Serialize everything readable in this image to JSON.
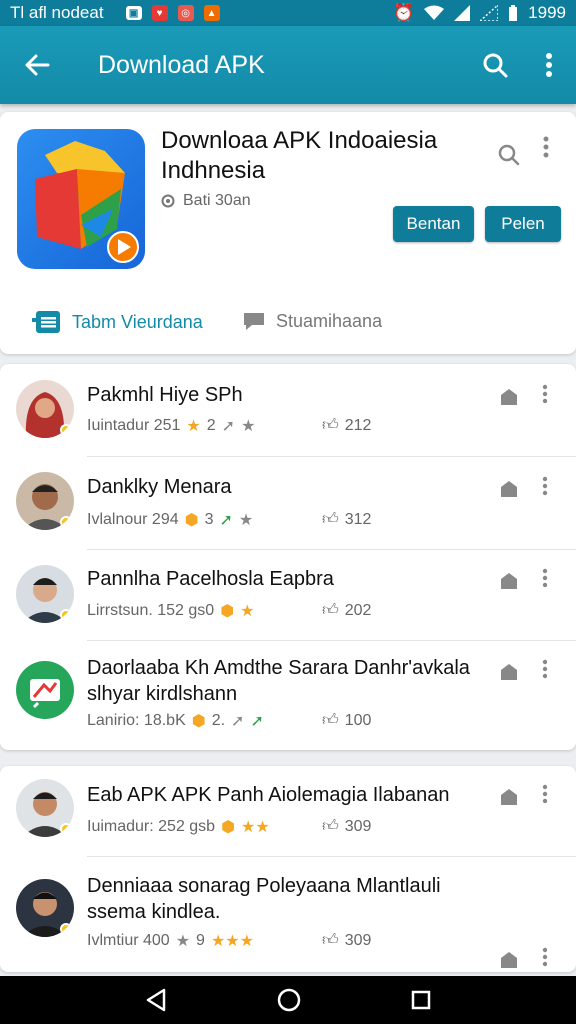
{
  "status_bar": {
    "carrier": "Tl afl nodeat",
    "time": "1999"
  },
  "app_bar": {
    "title": "Download APK"
  },
  "app_card": {
    "title": "Downloaa APK Indoaiesia Indhnesia",
    "subtitle": "Bati 30an",
    "button_1": "Bentan",
    "button_2": "Pelen",
    "tab_1": "Tabm Vieurdana",
    "tab_2": "Stuamihaana"
  },
  "list_1": [
    {
      "title": "Pakmhl Hiye SPh",
      "meta": "Iuintadur 251",
      "rating": "2",
      "likes": "212"
    },
    {
      "title": "Danklky Menara",
      "meta": "Ivlalnour 294",
      "rating": "3",
      "likes": "312"
    },
    {
      "title": "Pannlha Pacelhosla Eapbra",
      "meta": "Lirrstsun. 152 gs0",
      "rating": "",
      "likes": "202"
    },
    {
      "title": "Daorlaaba Kh Amdthe Sarara Danhr'avkala slhyar kirdlshann",
      "meta": "Lanirio: 18.bK",
      "rating": "2.",
      "likes": "100"
    }
  ],
  "list_2": [
    {
      "title": "Eab APK APK Panh Aiolemagia Ilabanan",
      "meta": "Iuimadur: 252 gsb",
      "rating": "",
      "likes": "309"
    },
    {
      "title": "Denniaaa sonarag Poleyaana Mlantlauli ssema kindlea.",
      "meta": "Ivlmtiur 400",
      "rating": "9",
      "likes": "309"
    }
  ],
  "colors": {
    "primary": "#138aa8",
    "accent": "#f5a623",
    "status_bar": "#0e7c9b"
  }
}
